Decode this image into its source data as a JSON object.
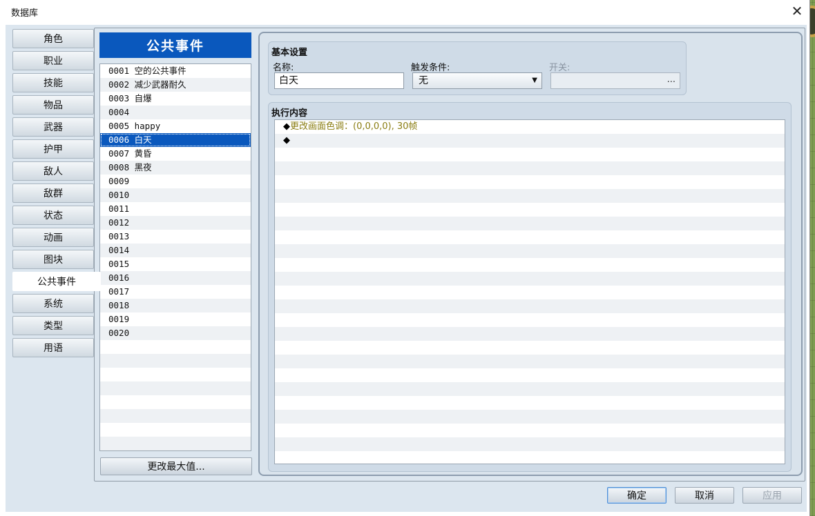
{
  "window": {
    "title": "数据库",
    "close_glyph": "✕"
  },
  "categories": [
    "角色",
    "职业",
    "技能",
    "物品",
    "武器",
    "护甲",
    "敌人",
    "敌群",
    "状态",
    "动画",
    "图块",
    "公共事件",
    "系统",
    "类型",
    "用语"
  ],
  "active_category": "公共事件",
  "event_list": {
    "header": "公共事件",
    "items": [
      "0001 空的公共事件",
      "0002 减少武器耐久",
      "0003 自爆",
      "0004",
      "0005 happy",
      "0006 白天",
      "0007 黄昏",
      "0008 黑夜",
      "0009",
      "0010",
      "0011",
      "0012",
      "0013",
      "0014",
      "0015",
      "0016",
      "0017",
      "0018",
      "0019",
      "0020"
    ],
    "selected": "0006 白天",
    "change_max_label": "更改最大值..."
  },
  "basic": {
    "title": "基本设置",
    "name_label": "名称:",
    "name_value": "白天",
    "trigger_label": "触发条件:",
    "trigger_value": "无",
    "switch_label": "开关:",
    "switch_dots": "..."
  },
  "exec": {
    "title": "执行内容",
    "diamond": "◆",
    "commands": [
      "更改画面色调：(0,0,0,0), 30帧",
      ""
    ]
  },
  "buttons": {
    "ok": "确定",
    "cancel": "取消",
    "apply": "应用"
  },
  "colors": {
    "selection": "#0a58bd",
    "command_text": "#8a7d12"
  }
}
